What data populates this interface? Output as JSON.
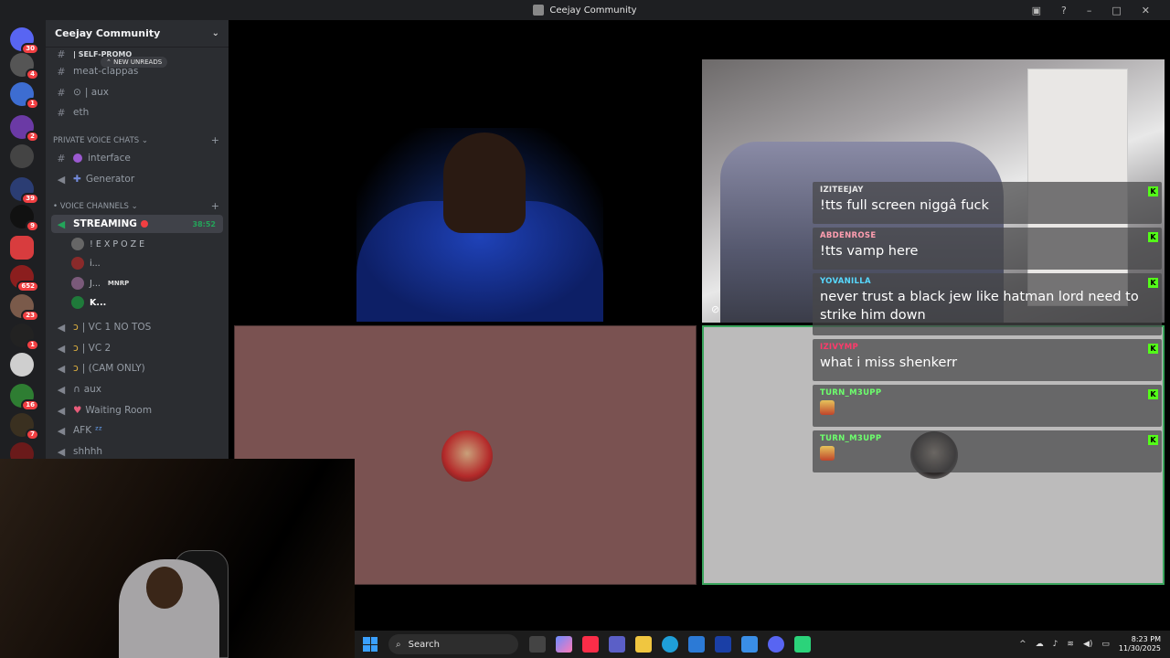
{
  "window": {
    "title": "Ceejay Community"
  },
  "server_rail": {
    "servers": [
      {
        "name": "discord-home-icon",
        "badge": "30"
      },
      {
        "name": "server-1",
        "badge": "4"
      },
      {
        "name": "server-2",
        "badge": "1"
      },
      {
        "name": "server-3",
        "badge": "2"
      },
      {
        "name": "server-4",
        "badge": ""
      },
      {
        "name": "server-5",
        "badge": "39"
      },
      {
        "name": "server-6",
        "badge": "9"
      },
      {
        "name": "server-7",
        "badge": ""
      },
      {
        "name": "server-8",
        "badge": "652"
      },
      {
        "name": "server-9",
        "badge": "23"
      },
      {
        "name": "server-10",
        "badge": "1"
      },
      {
        "name": "server-11",
        "badge": ""
      },
      {
        "name": "server-12",
        "badge": "16"
      },
      {
        "name": "server-13",
        "badge": "7"
      },
      {
        "name": "server-14",
        "badge": ""
      }
    ]
  },
  "sidebar": {
    "server_name": "Ceejay Community",
    "new_unreads": "NEW UNREADS",
    "text_channels": [
      "| SELF-PROMO",
      "meat-clappas",
      "| aux",
      "eth"
    ],
    "private_category": "PRIVATE VOICE CHATS",
    "private_channels": [
      "interface",
      "Generator"
    ],
    "voice_category": "VOICE CHANNELS",
    "streaming_channel": {
      "label": "STREAMING",
      "time": "38:52"
    },
    "members": [
      "! E X P O Z E",
      "i...",
      "J...",
      "MNRP",
      "K..."
    ],
    "voice_channels": [
      "| VC 1 NO TOS",
      "| VC 2",
      "| (CAM ONLY)",
      "aux",
      "Waiting Room",
      "AFK",
      "shhhh"
    ]
  },
  "chat": {
    "messages": [
      {
        "user": "IZITEEJAY",
        "color": "#e9e9e9",
        "text": "!tts full screen niggâ fuck"
      },
      {
        "user": "ABDENROSE",
        "color": "#ff9eb0",
        "text": "!tts vamp here"
      },
      {
        "user": "YOVANILLA",
        "color": "#57d9ff",
        "text": "never trust a black jew like hatman lord need to strike him down"
      },
      {
        "user": "IZIVYMP",
        "color": "#ff3a6b",
        "text": "what i miss shenkerr"
      },
      {
        "user": "TURN_M3UPP",
        "color": "#6dff6d",
        "text": ""
      },
      {
        "user": "TURN_M3UPP",
        "color": "#6dff6d",
        "text": ""
      }
    ],
    "badge_letter": "K"
  },
  "taskbar": {
    "search_placeholder": "Search",
    "time": "8:23 PM",
    "date": "11/30/2025"
  },
  "colors": {
    "accent_green": "#23a55a",
    "kick_green": "#53fc18",
    "live_red": "#f23f42"
  }
}
